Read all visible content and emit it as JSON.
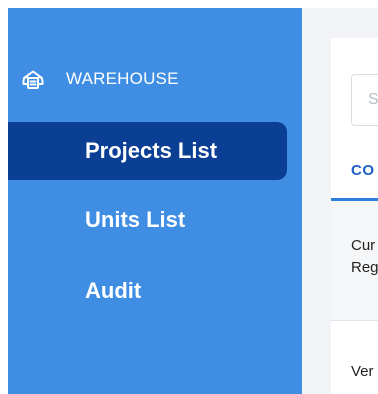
{
  "colors": {
    "sidebar_bg": "#3f8ee3",
    "active_item_bg": "#0b3f94",
    "sidebar_text": "#ffffff",
    "main_bg": "#f3f4f7",
    "tab_accent": "#1d5fc4"
  },
  "sidebar": {
    "brand": {
      "icon": "warehouse-icon",
      "label": "WAREHOUSE"
    },
    "items": [
      {
        "label": "Projects List",
        "active": true
      },
      {
        "label": "Units List",
        "active": false
      },
      {
        "label": "Audit",
        "active": false
      }
    ]
  },
  "main": {
    "search": {
      "placeholder": "S"
    },
    "tab": {
      "label": "CO"
    },
    "info": {
      "line1": "Cur",
      "line2": "Reg"
    },
    "row": {
      "text": "Ver"
    }
  }
}
